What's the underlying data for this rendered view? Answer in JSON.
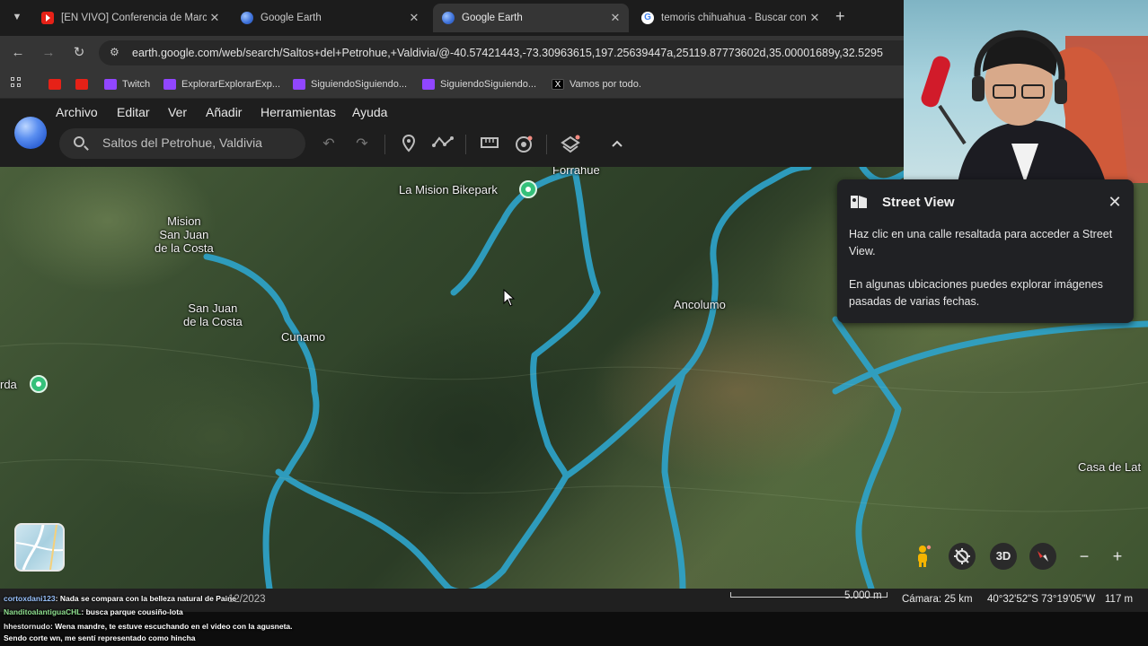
{
  "browser": {
    "tabs": [
      {
        "title": "[EN VIVO] Conferencia de Marc",
        "favicon": "youtube-icon",
        "active": false
      },
      {
        "title": "Google Earth",
        "favicon": "google-earth-icon",
        "active": false
      },
      {
        "title": "Google Earth",
        "favicon": "google-earth-icon",
        "active": true
      },
      {
        "title": "temoris chihuahua - Buscar con",
        "favicon": "google-icon",
        "active": false
      }
    ],
    "url": "earth.google.com/web/search/Saltos+del+Petrohue,+Valdivia/@-40.57421443,-73.30963615,197.25639447a,25119.87773602d,35.00001689y,32.5295",
    "bookmarks": [
      {
        "label": "",
        "icon": "youtube-icon"
      },
      {
        "label": "",
        "icon": "youtube-icon"
      },
      {
        "label": "Twitch",
        "icon": "twitch-icon"
      },
      {
        "label": "ExplorarExplorarExp...",
        "icon": "twitch-icon"
      },
      {
        "label": "SiguiendoSiguiendo...",
        "icon": "twitch-icon"
      },
      {
        "label": "SiguiendoSiguiendo...",
        "icon": "twitch-icon"
      },
      {
        "label": "Vamos por todo.",
        "icon": "x-icon"
      }
    ]
  },
  "earth": {
    "menu": [
      "Archivo",
      "Editar",
      "Ver",
      "Añadir",
      "Herramientas",
      "Ayuda"
    ],
    "search_value": "Saltos del Petrohue, Valdivia",
    "places": {
      "forrahue": "Forrahue",
      "bikepark": "La Mision Bikepark",
      "mision": "Mision\nSan Juan\nde la Costa",
      "sanjuan": "San Juan\nde la Costa",
      "cunamo": "Cunamo",
      "ancolumo": "Ancolumo",
      "rda": "rda",
      "casa": "Casa de Lat"
    },
    "street_view": {
      "title": "Street View",
      "text1": "Haz clic en una calle resaltada para acceder a Street View.",
      "text2": "En algunas ubicaciones puedes explorar imágenes pasadas de varias fechas."
    },
    "controls": {
      "three_d": "3D"
    },
    "status": {
      "date": "12/2023",
      "scale": "5.000 m",
      "camera": "Cámara: 25 km",
      "coords": "40°32'52\"S 73°19'05\"W",
      "elevation": "117 m"
    }
  },
  "chat": [
    {
      "user": "cortoxdani123",
      "text": ": Nada se compara con la belleza natural de Paine"
    },
    {
      "user": "NanditoalantiguaCHL",
      "text": ": busca parque cousiño-lota"
    },
    {
      "user": "hhestornudo",
      "text": ": Wena mandre, te estuve escuchando en el video con la agusneta."
    },
    {
      "user": "",
      "text": "Sendo corte wn, me sentí representado como hincha"
    }
  ]
}
